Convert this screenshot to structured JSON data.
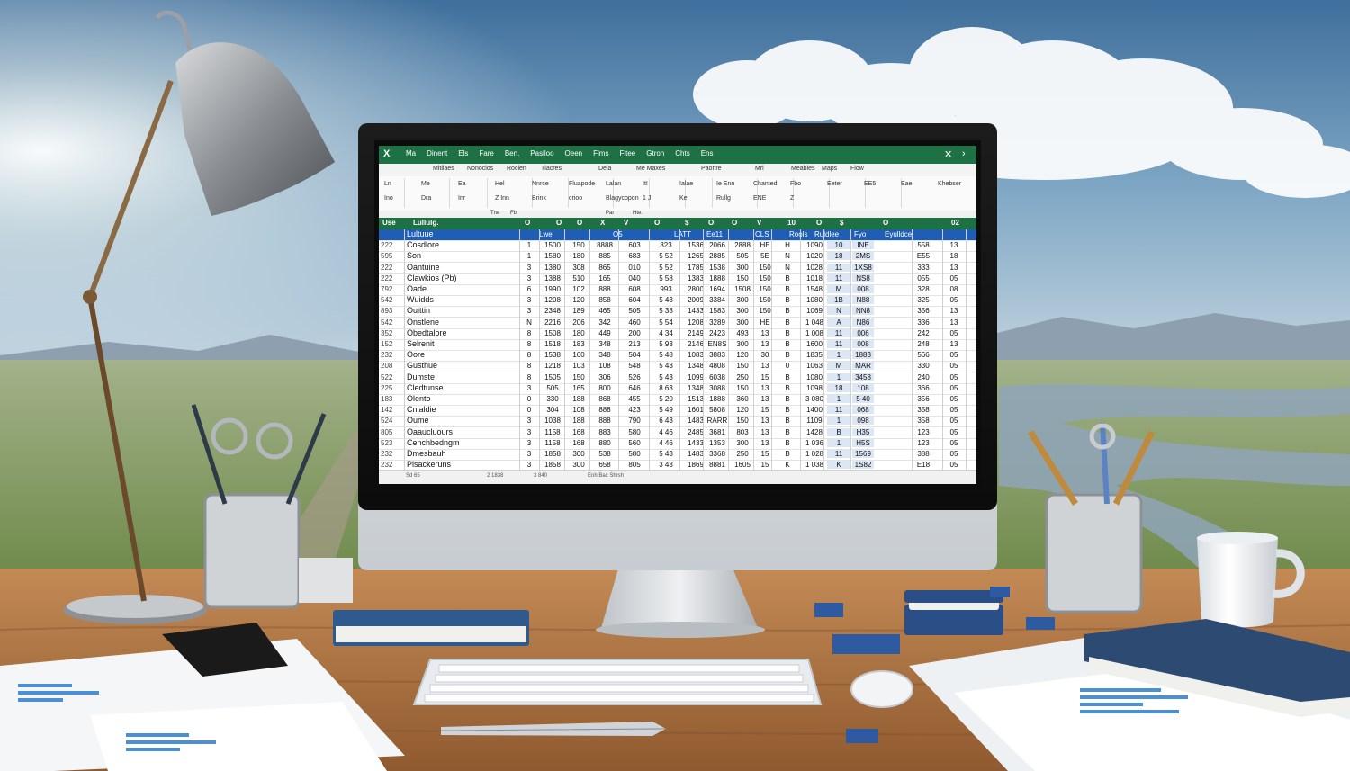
{
  "spreadsheet": {
    "title_tabs": [
      "Ma",
      "Dinent",
      "Els",
      "Fare",
      "Ben.",
      "Paslloo",
      "Oeen",
      "Flms",
      "Fitee",
      "Gtron",
      "Chts",
      "Ens"
    ],
    "ribbon_tabs": [
      "Mitilaes",
      "Nonocios",
      "Roclen",
      "Tlacres",
      "Dela",
      "Me Maxes",
      "Paonre",
      "Mrl",
      "Meables",
      "Maps",
      "Flow"
    ],
    "ribbon_labels": [
      "Ln",
      "Me",
      "Ea",
      "Hel",
      "Nnrce",
      "Fluapode",
      "Lalan",
      "ItI",
      "Ialae",
      "Ie Enn",
      "Chanted",
      "Fbo",
      "Eeter",
      "EE5",
      "Eae",
      "Khebser",
      "Ino",
      "Dra",
      "Inr",
      "Z Inn",
      "Brink",
      "crioo",
      "Blagycopon",
      "1 J",
      "Ke",
      "Rullg",
      "ENE",
      "Z"
    ],
    "formula_bar": [
      "Tne",
      "Fb",
      "Par",
      "Hte."
    ],
    "column_headers": [
      "Use",
      "Lullulg.",
      "O",
      "O",
      "O",
      "X",
      "V",
      "O",
      "$",
      "O",
      "O",
      "V",
      "10",
      "O",
      "$",
      "O",
      "02"
    ],
    "header_row": {
      "name": "Lultuue",
      "cells": [
        "Lwe",
        "O5",
        "LATT",
        "Ee11",
        "CLS",
        "Rools",
        "Ruldlee",
        "Fyo",
        "Eyulldce"
      ]
    },
    "rows": [
      {
        "n": "222",
        "name": "Cosdlore",
        "cells": [
          "1",
          "1500",
          "150",
          "8888",
          "603",
          "823",
          "1536",
          "2066",
          "2888",
          "HE",
          "H",
          "1090",
          "10",
          "INE",
          "558",
          "13"
        ]
      },
      {
        "n": "595",
        "name": "Son",
        "cells": [
          "1",
          "1580",
          "180",
          "885",
          "683",
          "5 52",
          "1265",
          "2885",
          "505",
          "5E",
          "N",
          "1020",
          "18",
          "2MS",
          "E55",
          "18"
        ]
      },
      {
        "n": "222",
        "name": "Oantuine",
        "cells": [
          "3",
          "1380",
          "308",
          "865",
          "010",
          "5 52",
          "1785",
          "1538",
          "300",
          "150",
          "N",
          "1028",
          "11",
          "1XS8",
          "333",
          "13"
        ]
      },
      {
        "n": "222",
        "name": "Clawkios (Pb)",
        "cells": [
          "3",
          "1388",
          "510",
          "165",
          "040",
          "5 58",
          "1383",
          "1888",
          "150",
          "150",
          "B",
          "1018",
          "11",
          "NS8",
          "055",
          "05"
        ]
      },
      {
        "n": "792",
        "name": "Oade",
        "cells": [
          "6",
          "1990",
          "102",
          "888",
          "608",
          "993",
          "2800",
          "1694",
          "1508",
          "150",
          "B",
          "1548",
          "M",
          "008",
          "328",
          "08"
        ]
      },
      {
        "n": "542",
        "name": "Wuidds",
        "cells": [
          "3",
          "1208",
          "120",
          "858",
          "604",
          "5 43",
          "2009",
          "3384",
          "300",
          "150",
          "B",
          "1080",
          "1B",
          "N88",
          "325",
          "05"
        ]
      },
      {
        "n": "893",
        "name": "Ouittin",
        "cells": [
          "3",
          "2348",
          "189",
          "465",
          "505",
          "5 33",
          "1433",
          "1583",
          "300",
          "150",
          "B",
          "1069",
          "N",
          "NN8",
          "356",
          "13"
        ]
      },
      {
        "n": "542",
        "name": "Onstlene",
        "cells": [
          "N",
          "2216",
          "206",
          "342",
          "460",
          "5 54",
          "1208",
          "3289",
          "300",
          "HE",
          "B",
          "1 048",
          "A",
          "N86",
          "336",
          "13"
        ]
      },
      {
        "n": "352",
        "name": "Obedtalore",
        "cells": [
          "8",
          "1508",
          "180",
          "449",
          "200",
          "4 34",
          "2149",
          "2423",
          "493",
          "13",
          "B",
          "1 008",
          "11",
          "006",
          "242",
          "05"
        ]
      },
      {
        "n": "152",
        "name": "Selrenit",
        "cells": [
          "8",
          "1518",
          "183",
          "348",
          "213",
          "5 93",
          "2146",
          "EN8S",
          "300",
          "13",
          "B",
          "1600",
          "11",
          "008",
          "248",
          "13"
        ]
      },
      {
        "n": "232",
        "name": "Oore",
        "cells": [
          "8",
          "1538",
          "160",
          "348",
          "504",
          "5 48",
          "1083",
          "3883",
          "120",
          "30",
          "B",
          "1835",
          "1",
          "1883",
          "566",
          "05"
        ]
      },
      {
        "n": "208",
        "name": "Gusthue",
        "cells": [
          "8",
          "1218",
          "103",
          "108",
          "548",
          "5 43",
          "1348",
          "4808",
          "150",
          "13",
          "0",
          "1063",
          "M",
          "MAR",
          "330",
          "05"
        ]
      },
      {
        "n": "522",
        "name": "Dumste",
        "cells": [
          "8",
          "1505",
          "150",
          "306",
          "526",
          "5 43",
          "1099",
          "6038",
          "250",
          "15",
          "B",
          "1080",
          "1",
          "3458",
          "240",
          "05"
        ]
      },
      {
        "n": "225",
        "name": "Cledtunse",
        "cells": [
          "3",
          "505",
          "165",
          "800",
          "646",
          "8 63",
          "1348",
          "3088",
          "150",
          "13",
          "B",
          "1098",
          "18",
          "108",
          "366",
          "05"
        ]
      },
      {
        "n": "183",
        "name": "Olento",
        "cells": [
          "0",
          "330",
          "188",
          "868",
          "455",
          "5 20",
          "1513",
          "1888",
          "360",
          "13",
          "B",
          "3 080",
          "1",
          "5 40",
          "356",
          "05"
        ]
      },
      {
        "n": "142",
        "name": "Cnialdie",
        "cells": [
          "0",
          "304",
          "108",
          "888",
          "423",
          "5 49",
          "1601",
          "5808",
          "120",
          "15",
          "B",
          "1400",
          "11",
          "068",
          "358",
          "05"
        ]
      },
      {
        "n": "524",
        "name": "Oume",
        "cells": [
          "3",
          "1038",
          "188",
          "888",
          "790",
          "6 43",
          "1483",
          "RARR",
          "150",
          "13",
          "B",
          "1109",
          "1",
          "098",
          "358",
          "05"
        ]
      },
      {
        "n": "805",
        "name": "Oaaucluours",
        "cells": [
          "3",
          "1158",
          "168",
          "883",
          "580",
          "4 46",
          "2485",
          "3681",
          "803",
          "13",
          "B",
          "1428",
          "B",
          "H35",
          "123",
          "05"
        ]
      },
      {
        "n": "523",
        "name": "Cenchbedngm",
        "cells": [
          "3",
          "1158",
          "168",
          "880",
          "560",
          "4 46",
          "1433",
          "1353",
          "300",
          "13",
          "B",
          "1 036",
          "1",
          "H5S",
          "123",
          "05"
        ]
      },
      {
        "n": "232",
        "name": "Dmesbauh",
        "cells": [
          "3",
          "1858",
          "300",
          "538",
          "580",
          "5 43",
          "1483",
          "3368",
          "250",
          "15",
          "B",
          "1 028",
          "11",
          "1569",
          "388",
          "05"
        ]
      },
      {
        "n": "232",
        "name": "Plsackeruns",
        "cells": [
          "3",
          "1858",
          "300",
          "658",
          "805",
          "3 43",
          "1869",
          "8881",
          "1605",
          "15",
          "K",
          "1 038",
          "K",
          "1S82",
          "E18",
          "05"
        ]
      }
    ],
    "status_items": [
      "Sd 65",
      "2 1838",
      "3 840",
      "Enh Bac Shrsh"
    ],
    "accent": "#1e7145",
    "selection": "#1f5eb4"
  }
}
